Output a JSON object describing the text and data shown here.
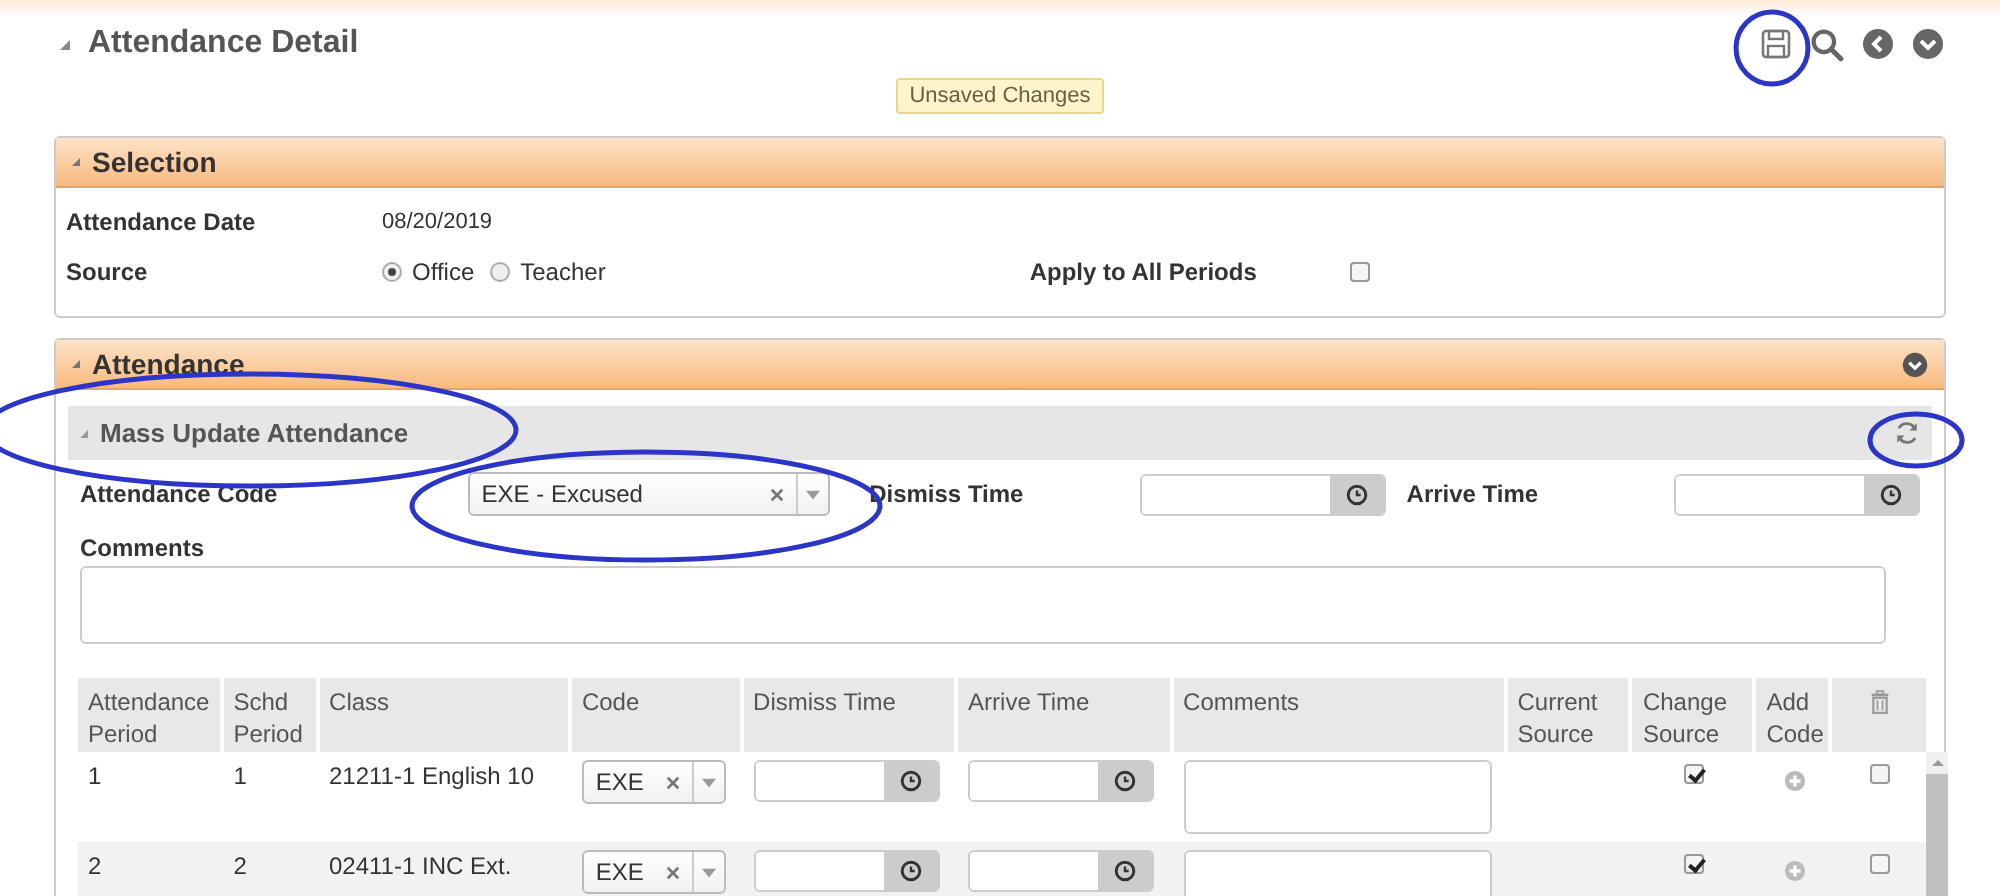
{
  "page": {
    "title": "Attendance Detail",
    "status_badge": "Unsaved Changes"
  },
  "selection": {
    "title": "Selection",
    "date_label": "Attendance Date",
    "date_value": "08/20/2019",
    "source_label": "Source",
    "source_options": [
      {
        "label": "Office",
        "selected": true
      },
      {
        "label": "Teacher",
        "selected": false
      }
    ],
    "apply_all_label": "Apply to All Periods",
    "apply_all_checked": false
  },
  "attendance": {
    "title": "Attendance",
    "mass_update": {
      "title": "Mass Update Attendance",
      "code_label": "Attendance Code",
      "code_value": "EXE - Excused",
      "dismiss_label": "Dismiss Time",
      "arrive_label": "Arrive Time",
      "comments_label": "Comments"
    },
    "table": {
      "columns": [
        "Attendance Period",
        "Schd Period",
        "Class",
        "Code",
        "Dismiss Time",
        "Arrive Time",
        "Comments",
        "Current Source",
        "Change Source",
        "Add Code"
      ],
      "rows": [
        {
          "attendance_period": "1",
          "schd_period": "1",
          "class": "21211-1 English 10",
          "code": "EXE",
          "change_source": true,
          "delete": false
        },
        {
          "attendance_period": "2",
          "schd_period": "2",
          "class": "02411-1 INC Ext.",
          "code": "EXE",
          "change_source": true,
          "delete": false
        }
      ]
    }
  }
}
